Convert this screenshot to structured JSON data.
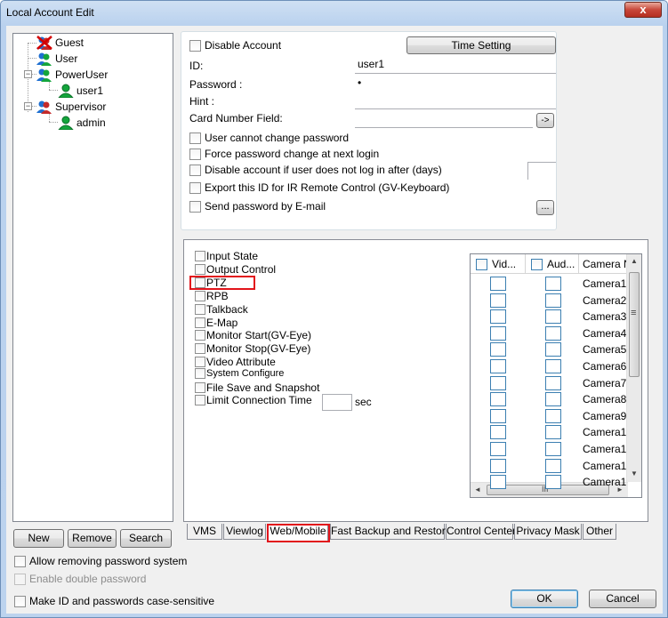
{
  "window": {
    "title": "Local Account Edit",
    "close_glyph": "x"
  },
  "tree": {
    "nodes": [
      {
        "label": "Guest",
        "icon": "user-disabled-icon"
      },
      {
        "label": "User",
        "icon": "user-group-icon"
      },
      {
        "label": "PowerUser",
        "icon": "user-group-icon"
      },
      {
        "label": "user1",
        "icon": "user-icon"
      },
      {
        "label": "Supervisor",
        "icon": "user-group-icon"
      },
      {
        "label": "admin",
        "icon": "user-icon"
      }
    ],
    "new_label": "New",
    "remove_label": "Remove",
    "search_label": "Search"
  },
  "account": {
    "disable_account_label": "Disable Account",
    "time_setting_label": "Time Setting",
    "id_label": "ID:",
    "id_value": "user1",
    "password_label": "Password :",
    "password_value": "•",
    "hint_label": "Hint :",
    "hint_value": "",
    "card_label": "Card Number Field:",
    "card_value": "",
    "card_button": "->",
    "user_cannot_change": "User cannot change password",
    "force_change": "Force password change at next login",
    "disable_if_not_login": "Disable account if user does not log in after (days)",
    "days_value": "",
    "export_ir": "Export this ID for IR Remote Control (GV-Keyboard)",
    "send_email": "Send password by E-mail",
    "email_button": "..."
  },
  "permissions": {
    "items": [
      "Input State",
      "Output Control",
      "PTZ",
      "RPB",
      "Talkback",
      "E-Map",
      "Monitor Start(GV-Eye)",
      "Monitor Stop(GV-Eye)",
      "Video Attribute",
      "System Configure",
      "File Save and Snapshot",
      "Limit Connection Time"
    ],
    "limit_value": "",
    "limit_unit": "sec",
    "highlighted": "PTZ"
  },
  "camera_grid": {
    "headers": [
      "Vid...",
      "Aud...",
      "Camera N"
    ],
    "rows": [
      "Camera1",
      "Camera2",
      "Camera3",
      "Camera4",
      "Camera5",
      "Camera6",
      "Camera7",
      "Camera8",
      "Camera9",
      "Camera1",
      "Camera1",
      "Camera1",
      "Camera1"
    ],
    "scroll_marker": "≡",
    "hscroll_marker": "III",
    "left_arrow": "◄",
    "right_arrow": "►",
    "up_arrow": "▲",
    "down_arrow": "▼"
  },
  "tabs": [
    {
      "label": "VMS"
    },
    {
      "label": "Viewlog"
    },
    {
      "label": "Web/Mobile"
    },
    {
      "label": "Fast Backup and Restore"
    },
    {
      "label": "Control Center"
    },
    {
      "label": "Privacy Mask"
    },
    {
      "label": "Other"
    }
  ],
  "active_tab": "Web/Mobile",
  "footer": {
    "allow_removing": "Allow removing password system",
    "enable_double": "Enable double password",
    "case_sensitive": "Make ID and passwords case-sensitive",
    "ok_label": "OK",
    "cancel_label": "Cancel"
  },
  "colors": {
    "highlight": "#e2141b",
    "group_user": "#1e6fd1",
    "user_green": "#14a53c"
  }
}
